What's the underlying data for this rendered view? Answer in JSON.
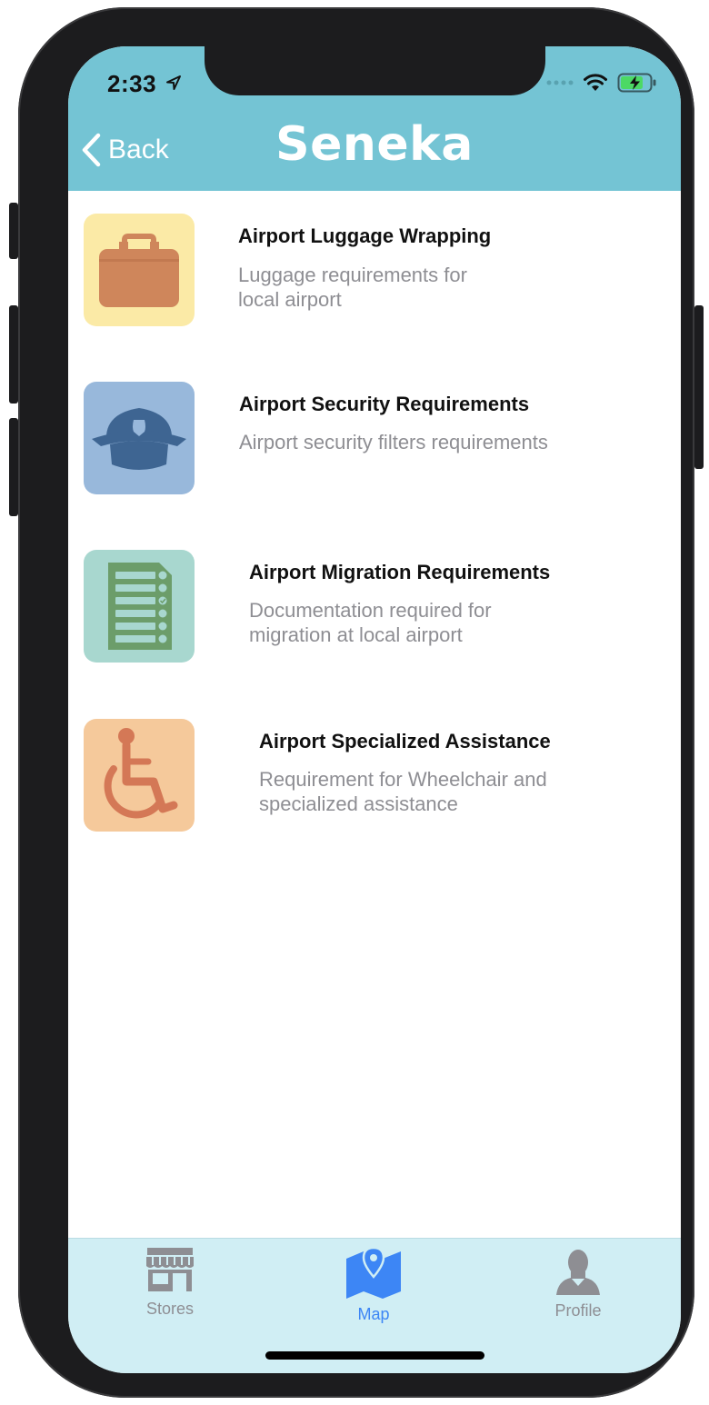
{
  "status_bar": {
    "time": "2:33"
  },
  "navbar": {
    "back_label": "Back",
    "title": "Seneka",
    "color": "#74c4d4"
  },
  "items": [
    {
      "icon": "suitcase-icon",
      "tile_color": "#fbeaa6",
      "title": "Airport Luggage Wrapping",
      "subtitle": "Luggage requirements for local airport"
    },
    {
      "icon": "police-cap-icon",
      "tile_color": "#98b8db",
      "title": "Airport Security Requirements",
      "subtitle": "Airport security filters requirements"
    },
    {
      "icon": "checklist-document-icon",
      "tile_color": "#a8d7cf",
      "title": "Airport Migration Requirements",
      "subtitle": "Documentation required for migration at local airport"
    },
    {
      "icon": "wheelchair-icon",
      "tile_color": "#f5c99b",
      "title": "Airport Specialized Assistance",
      "subtitle": "Requirement for Wheelchair and specialized assistance"
    }
  ],
  "tabbar": {
    "tabs": [
      {
        "label": "Stores",
        "icon": "storefront-icon",
        "active": false
      },
      {
        "label": "Map",
        "icon": "map-pin-icon",
        "active": true
      },
      {
        "label": "Profile",
        "icon": "person-icon",
        "active": false
      }
    ],
    "active_color": "#3d86f5",
    "inactive_color": "#8e8e93"
  }
}
